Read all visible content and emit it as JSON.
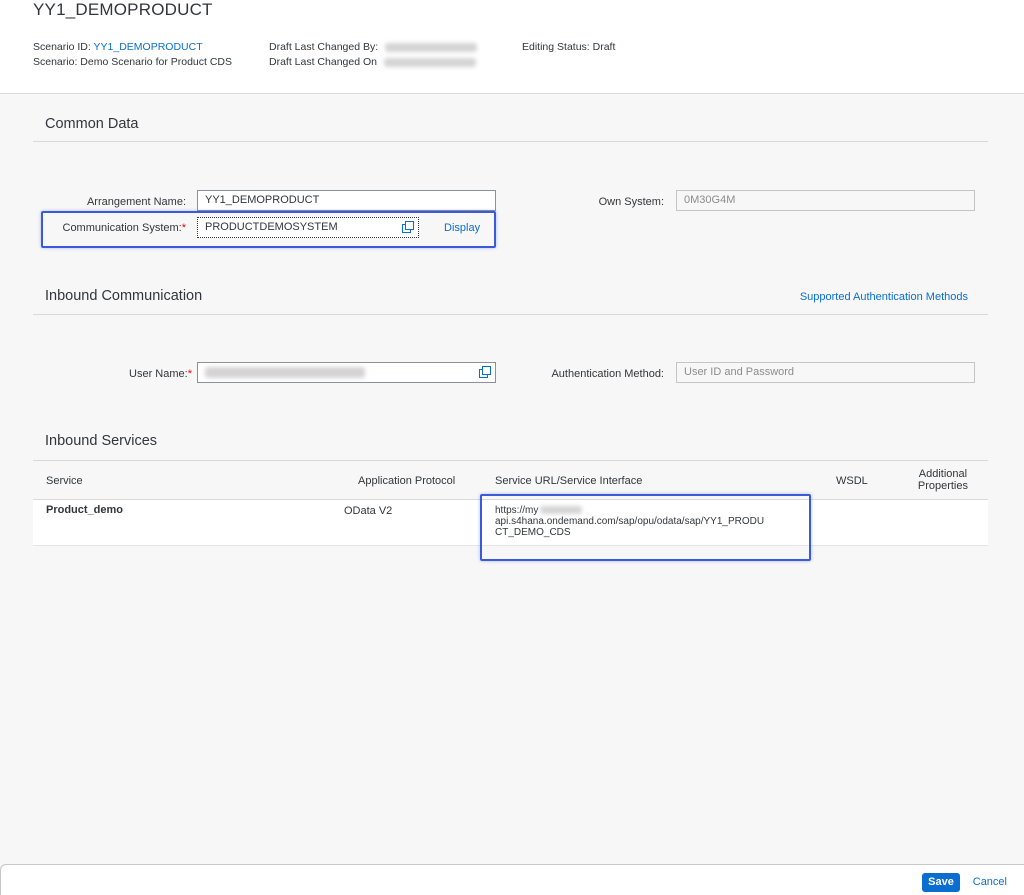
{
  "header": {
    "title": "YY1_DEMOPRODUCT",
    "scenario_id_label": "Scenario ID:",
    "scenario_id_value": "YY1_DEMOPRODUCT",
    "scenario_label": "Scenario:",
    "scenario_value": "Demo Scenario for Product CDS",
    "draft_changed_by_label": "Draft Last Changed By:",
    "draft_changed_on_label": "Draft Last Changed On",
    "editing_status_label": "Editing Status:",
    "editing_status_value": "Draft"
  },
  "common_data": {
    "title": "Common Data",
    "arrangement_name_label": "Arrangement Name:",
    "arrangement_name_value": "YY1_DEMOPRODUCT",
    "communication_system_label": "Communication System:",
    "communication_system_value": "PRODUCTDEMOSYSTEM",
    "display_link": "Display",
    "own_system_label": "Own System:",
    "own_system_value": "0M30G4M"
  },
  "inbound_communication": {
    "title": "Inbound Communication",
    "supported_auth_link": "Supported Authentication Methods",
    "user_name_label": "User Name:",
    "auth_method_label": "Authentication Method:",
    "auth_method_value": "User ID and Password"
  },
  "inbound_services": {
    "title": "Inbound Services",
    "columns": {
      "service": "Service",
      "protocol": "Application Protocol",
      "url": "Service URL/Service Interface",
      "wsdl": "WSDL",
      "additional_1": "Additional",
      "additional_2": "Properties"
    },
    "rows": [
      {
        "service": "Product_demo",
        "protocol": "OData V2",
        "url_1": "https://my",
        "url_2": "api.s4hana.ondemand.com/sap/opu/odata/sap/YY1_PRODU",
        "url_3": "CT_DEMO_CDS"
      }
    ]
  },
  "footer": {
    "save_label": "Save",
    "cancel_label": "Cancel"
  },
  "colors": {
    "accent": "#0a6ed1",
    "highlight": "#3a5ad8",
    "required": "#e00000"
  }
}
